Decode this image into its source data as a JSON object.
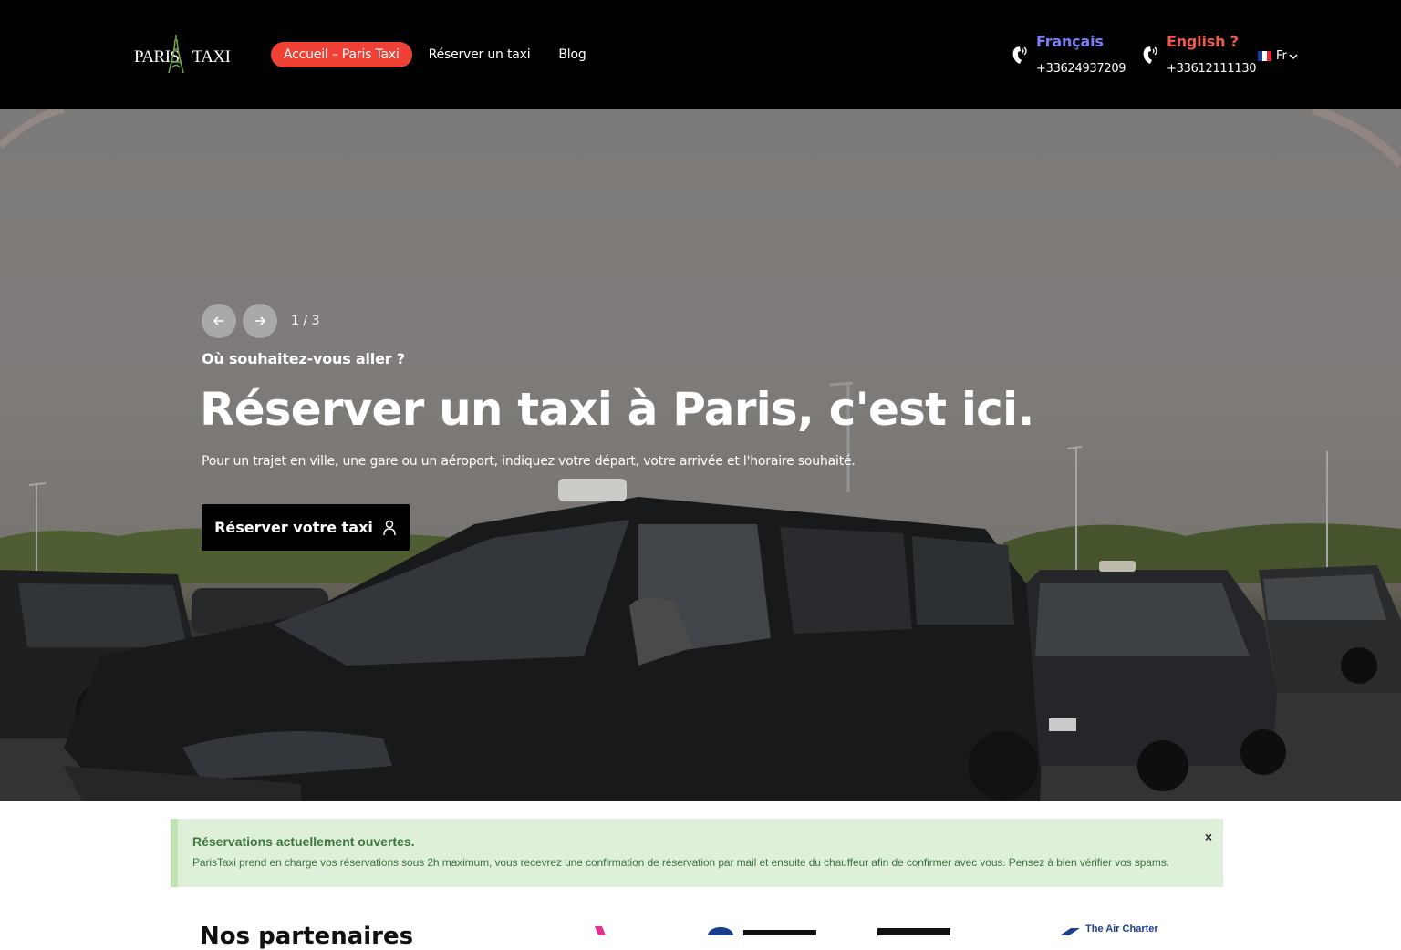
{
  "header": {
    "logo_text_left": "PARIS",
    "logo_text_right": "TAXI",
    "nav": [
      {
        "label": "Accueil – Paris Taxi",
        "active": true
      },
      {
        "label": "Réserver un taxi",
        "active": false
      },
      {
        "label": "Blog",
        "active": false
      }
    ],
    "contacts": [
      {
        "lang": "Français",
        "phone": "+33624937209",
        "color": "#7a7ff5"
      },
      {
        "lang": "English ?",
        "phone": "+33612111130",
        "color": "#ef5b50"
      }
    ],
    "language_selector": {
      "value": "Fr"
    }
  },
  "hero": {
    "counter": "1 / 3",
    "eyebrow": "Où souhaitez-vous aller ?",
    "title": "Réserver un taxi à Paris, c'est ici.",
    "subtitle": "Pour un trajet en ville, une gare ou un aéroport, indiquez votre départ, votre arrivée et l'horaire souhaité.",
    "cta_label": "Réserver votre taxi"
  },
  "alert": {
    "title": "Réservations actuellement ouvertes.",
    "text": "ParisTaxi prend en charge vos réservations sous 2h maximum, vous recevrez une confirmation de réservation par mail et ensuite du chauffeur afin de confirmer avec vous. Pensez à bien vérifier vos spams.",
    "close": "×"
  },
  "partners": {
    "title": "Nos partenaires",
    "air_charter": "The Air Charter"
  },
  "colors": {
    "accent": "#ef4136",
    "header_bg": "#000000",
    "alert_bg": "#dff0d8",
    "alert_text": "#3c763d"
  }
}
